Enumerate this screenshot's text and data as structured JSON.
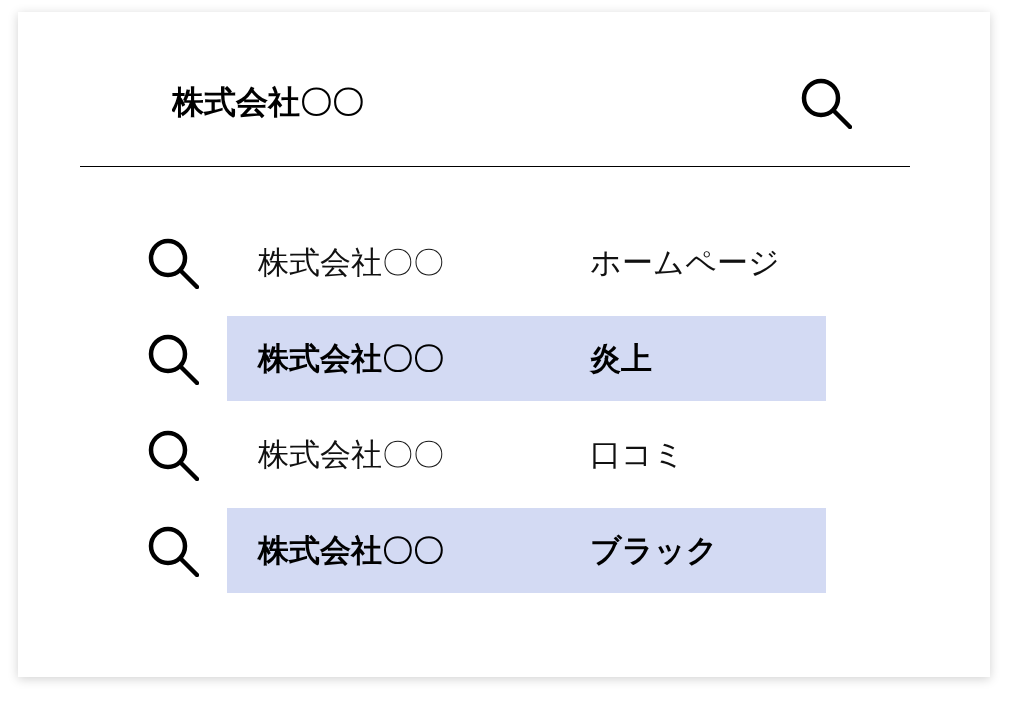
{
  "search": {
    "value": "株式会社〇〇"
  },
  "suggestions": [
    {
      "company": "株式会社〇〇",
      "term": "ホームページ",
      "selected": false
    },
    {
      "company": "株式会社〇〇",
      "term": "炎上",
      "selected": true
    },
    {
      "company": "株式会社〇〇",
      "term": "口コミ",
      "selected": false
    },
    {
      "company": "株式会社〇〇",
      "term": "ブラック",
      "selected": true
    }
  ]
}
